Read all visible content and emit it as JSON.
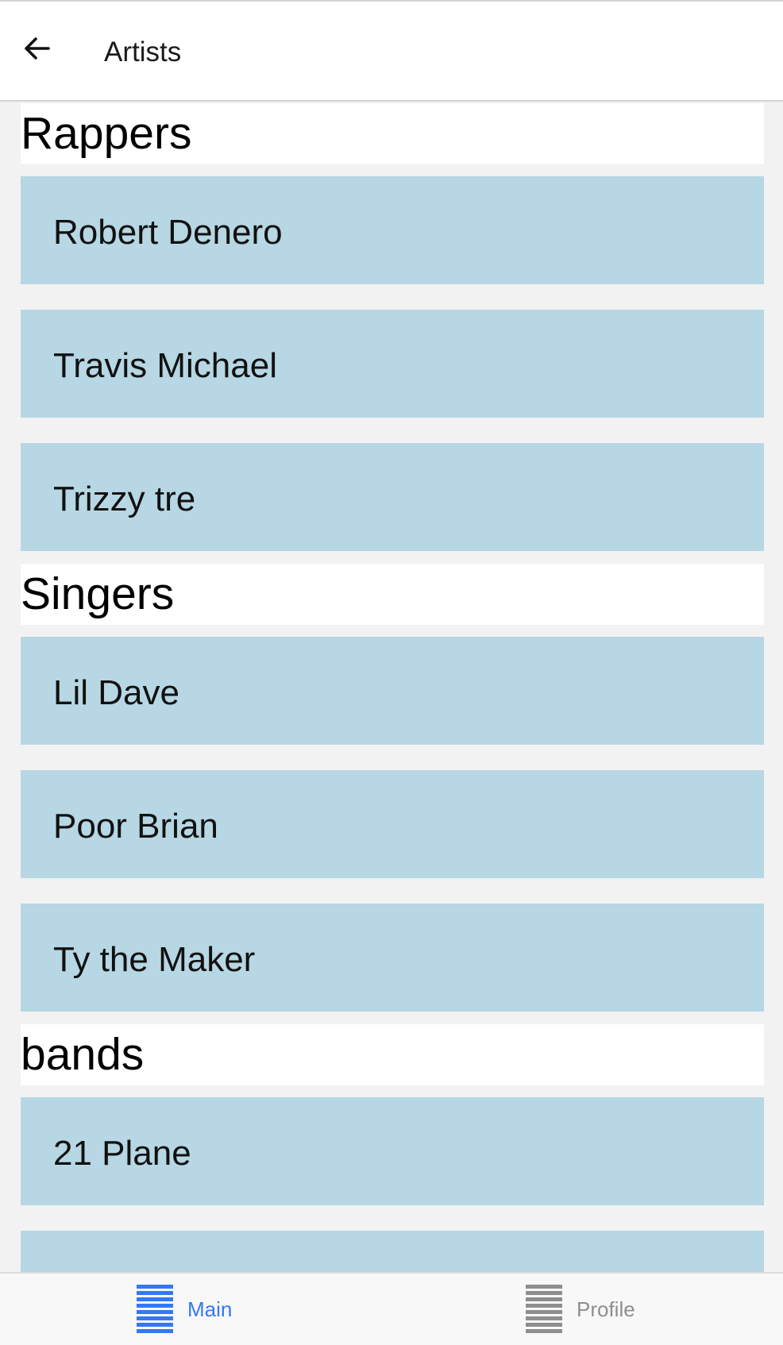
{
  "header": {
    "title": "Artists",
    "back_icon": "back-arrow-icon"
  },
  "sections": [
    {
      "title": "Rappers",
      "items": [
        "Robert Denero",
        "Travis Michael",
        "Trizzy tre"
      ]
    },
    {
      "title": "Singers",
      "items": [
        "Lil Dave",
        "Poor Brian",
        "Ty the Maker"
      ]
    },
    {
      "title": "bands",
      "items": [
        "21 Plane",
        ""
      ]
    }
  ],
  "tabs": [
    {
      "label": "Main",
      "icon": "list-icon",
      "active": true,
      "color": "#3478f6"
    },
    {
      "label": "Profile",
      "icon": "list-icon",
      "active": false,
      "color": "#8e8e8e"
    }
  ],
  "colors": {
    "item_background": "#b6d7e3",
    "section_background": "#ffffff",
    "page_background": "#f2f2f2",
    "active_tab": "#3478f6",
    "inactive_tab": "#8e8e8e"
  }
}
